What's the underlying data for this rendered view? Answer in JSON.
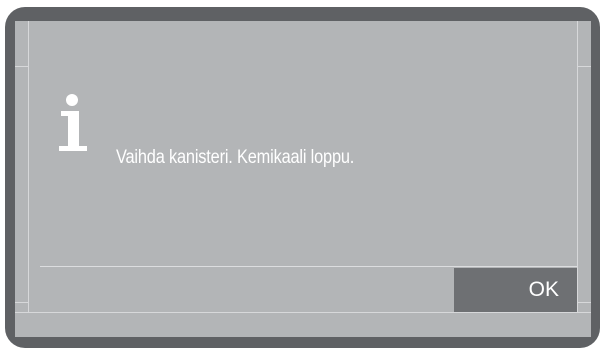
{
  "dialog": {
    "icon": "info-icon",
    "message": "Vaihda kanisteri. Kemikaali loppu.",
    "ok_label": "OK"
  },
  "colors": {
    "bezel": "#5f6164",
    "screen": "#b3b5b7",
    "button": "#6e7073",
    "text": "#ffffff"
  }
}
